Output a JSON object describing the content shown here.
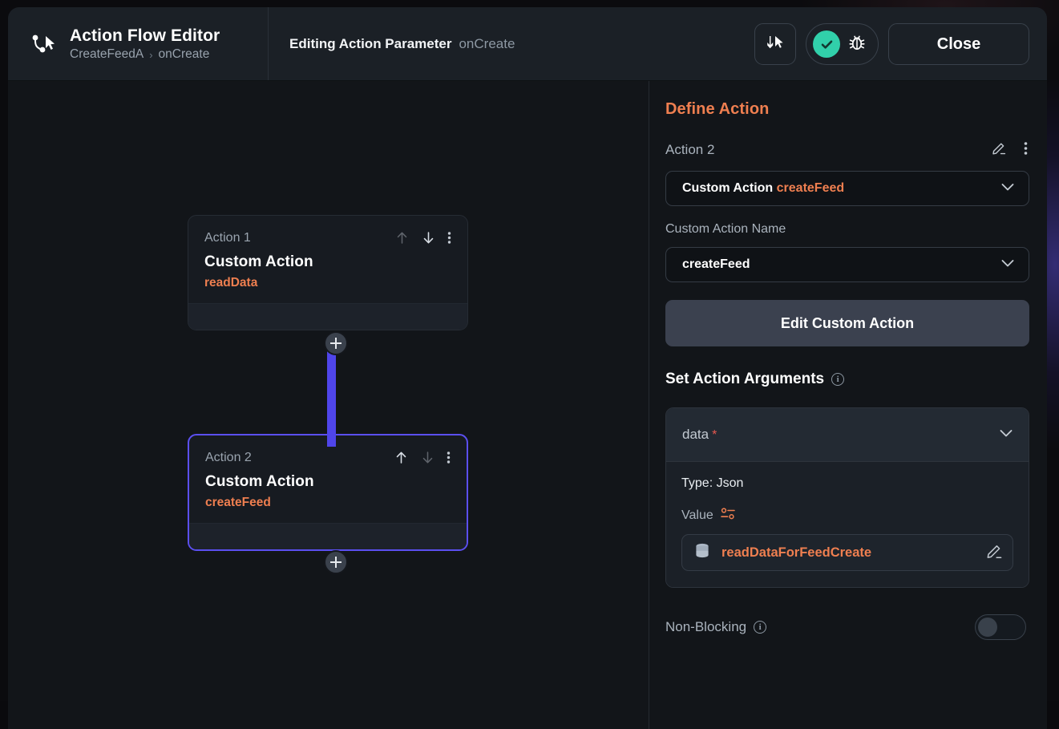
{
  "header": {
    "app_title": "Action Flow Editor",
    "breadcrumb_root": "CreateFeedA",
    "breadcrumb_sep": "›",
    "breadcrumb_leaf": "onCreate",
    "editing_label": "Editing Action Parameter",
    "editing_value": "onCreate",
    "flow_icon": "flow-cursor-icon",
    "undo_icon": "undo-flow-icon",
    "check_icon": "check-icon",
    "bug_icon": "bug-icon",
    "close_label": "Close"
  },
  "canvas": {
    "nodes": [
      {
        "label": "Action 1",
        "title": "Custom Action",
        "subtitle": "readData",
        "selected": false,
        "move_up_enabled": false,
        "move_down_enabled": true
      },
      {
        "label": "Action 2",
        "title": "Custom Action",
        "subtitle": "createFeed",
        "selected": true,
        "move_up_enabled": true,
        "move_down_enabled": false
      }
    ],
    "add_button_label": "+",
    "connector_color": "#4f45ea",
    "selected_border_color": "#5b4ff0"
  },
  "panel": {
    "title": "Define Action",
    "action_name": "Action 2",
    "edit_icon": "pencil-icon",
    "more_icon": "kebab-menu-icon",
    "action_type_prefix": "Custom Action",
    "action_type_value": "createFeed",
    "custom_action_name_label": "Custom Action Name",
    "custom_action_name_value": "createFeed",
    "edit_custom_action_label": "Edit Custom Action",
    "arguments_section_title": "Set Action Arguments",
    "arguments_info_icon": "info-icon",
    "argument": {
      "name": "data",
      "required_marker": "*",
      "chevron_icon": "chevron-down-icon",
      "type_line": "Type: Json",
      "value_label": "Value",
      "value_settings_icon": "sliders-icon",
      "value_source_icon": "database-icon",
      "value_text": "readDataForFeedCreate",
      "value_edit_icon": "pencil-icon"
    },
    "non_blocking_label": "Non-Blocking",
    "non_blocking_info_icon": "info-icon",
    "non_blocking_enabled": false
  },
  "colors": {
    "accent_orange": "#ef7f50",
    "accent_purple": "#5b4ff0",
    "accent_teal": "#31d0aa",
    "required_red": "#e8584f"
  }
}
